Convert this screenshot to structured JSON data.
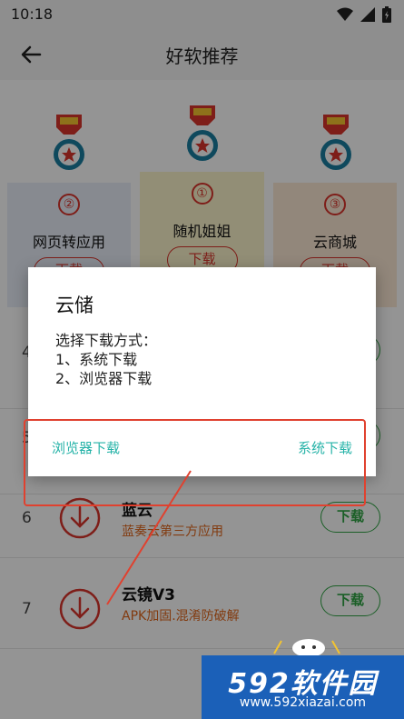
{
  "status_bar": {
    "time": "10:18",
    "icons": [
      "wifi-icon",
      "signal-icon",
      "battery-icon"
    ]
  },
  "app_bar": {
    "title": "好软推荐",
    "back_icon": "back-arrow-icon"
  },
  "podium": [
    {
      "rank": "②",
      "name": "网页转应用",
      "button": "下载"
    },
    {
      "rank": "①",
      "name": "随机姐姐",
      "button": "下载"
    },
    {
      "rank": "③",
      "name": "云商城",
      "button": "下载"
    }
  ],
  "list": [
    {
      "num": "4",
      "name": "",
      "desc": "",
      "button": "下载"
    },
    {
      "num": "5",
      "name": "",
      "desc": "",
      "button": "下载"
    },
    {
      "num": "6",
      "name": "蓝云",
      "desc": "蓝奏云第三方应用",
      "button": "下载"
    },
    {
      "num": "7",
      "name": "云镜V3",
      "desc": "APK加固.混淆防破解",
      "button": "下载"
    }
  ],
  "dialog": {
    "title": "云储",
    "message_lines": [
      "选择下载方式：",
      "1、系统下载",
      "2、浏览器下载"
    ],
    "left_button": "浏览器下载",
    "right_button": "系统下载"
  },
  "watermark": {
    "main": "592软件园",
    "url": "www.592xiazai.com"
  },
  "colors": {
    "accent_red": "#d9342b",
    "accent_green": "#2fa444",
    "dialog_button": "#26b3a8",
    "highlight": "#e0412f"
  }
}
